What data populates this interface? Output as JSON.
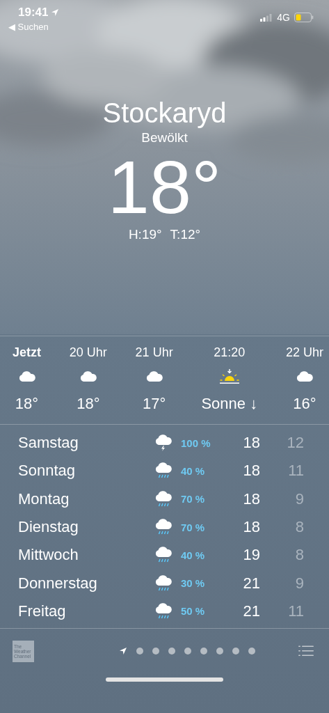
{
  "status_bar": {
    "time": "19:41",
    "back_label": "◀ Suchen",
    "network": "4G"
  },
  "location": {
    "city": "Stockaryd",
    "condition": "Bewölkt",
    "temperature": "18°",
    "high": "H:19°",
    "low": "T:12°"
  },
  "hourly": [
    {
      "label": "Jetzt",
      "now": true,
      "kind": "cloud",
      "value": "18°"
    },
    {
      "label": "20 Uhr",
      "now": false,
      "kind": "cloud",
      "value": "18°"
    },
    {
      "label": "21 Uhr",
      "now": false,
      "kind": "cloud",
      "value": "17°"
    },
    {
      "label": "21:20",
      "now": false,
      "kind": "sunset",
      "value": "Sonne ↓"
    },
    {
      "label": "22 Uhr",
      "now": false,
      "kind": "cloud",
      "value": "16°"
    }
  ],
  "daily": [
    {
      "day": "Samstag",
      "kind": "thunder",
      "chance": "100 %",
      "high": "18",
      "low": "12"
    },
    {
      "day": "Sonntag",
      "kind": "rain",
      "chance": "40 %",
      "high": "18",
      "low": "11"
    },
    {
      "day": "Montag",
      "kind": "rain",
      "chance": "70 %",
      "high": "18",
      "low": "9"
    },
    {
      "day": "Dienstag",
      "kind": "rain",
      "chance": "70 %",
      "high": "18",
      "low": "8"
    },
    {
      "day": "Mittwoch",
      "kind": "rain",
      "chance": "40 %",
      "high": "19",
      "low": "8"
    },
    {
      "day": "Donnerstag",
      "kind": "rain",
      "chance": "30 %",
      "high": "21",
      "low": "9"
    },
    {
      "day": "Freitag",
      "kind": "rain",
      "chance": "50 %",
      "high": "21",
      "low": "11"
    }
  ],
  "footer": {
    "logo_lines": [
      "The",
      "Weather",
      "Channel"
    ],
    "pages": [
      {
        "kind": "location",
        "selected": true
      },
      {
        "kind": "dot",
        "selected": false
      },
      {
        "kind": "dot",
        "selected": false
      },
      {
        "kind": "dot",
        "selected": false
      },
      {
        "kind": "dot",
        "selected": false
      },
      {
        "kind": "dot",
        "selected": false
      },
      {
        "kind": "dot",
        "selected": false
      },
      {
        "kind": "dot",
        "selected": false
      },
      {
        "kind": "dot",
        "selected": false
      }
    ]
  }
}
